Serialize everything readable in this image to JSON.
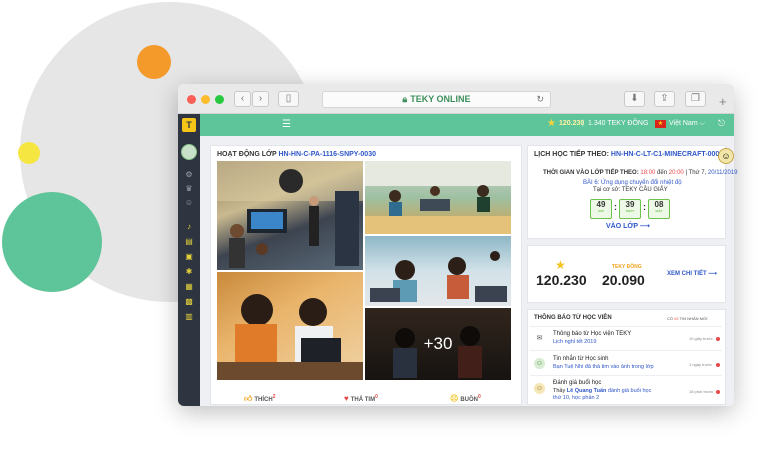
{
  "browser": {
    "url": "TEKY ONLINE"
  },
  "topbar": {
    "points": "120.230",
    "separator": "|",
    "coins_label": "1.340 TEKY ĐỒNG",
    "flag_star": "★",
    "language": "Việt Nam ⌵"
  },
  "activity": {
    "title": "HOẠT ĐỘNG LỚP",
    "class_code": "HN-HN-C-PA-1116-SNPY-0030",
    "more_photos": "+30",
    "likes_label": "THÍCH",
    "likes_count": "2",
    "loves_label": "THẢ TIM",
    "loves_count": "0",
    "sad_label": "BUỒN",
    "sad_count": "0"
  },
  "schedule": {
    "title": "LỊCH HỌC TIẾP THEO:",
    "class_code": "HN-HN-C-LT-C1-MINECRAFT-0001",
    "time_label": "THỜI GIAN VÀO LỚP TIẾP THEO:",
    "time_start": "18:00",
    "time_sep": " đến ",
    "time_end": "20:00",
    "day": "| Thứ 7,",
    "date": "20/11/2019",
    "lesson": "BÀI 6: Ứng dụng chuyển đổi nhiệt độ",
    "location": "Tại cơ sở: TEKY CẦU GIẤY",
    "hours": "49",
    "hours_label": "GIỜ",
    "minutes": "39",
    "minutes_label": "PHÚT",
    "seconds": "08",
    "seconds_label": "GIÂY",
    "join_label": "VÀO LỚP ⟶"
  },
  "stats": {
    "points": "120.230",
    "coins_label": "TEKY ĐỒNG",
    "coins": "20.090",
    "detail_label": "XEM CHI TIẾT ⟶"
  },
  "notifications": {
    "title": "THÔNG BÁO TỪ HỌC VIÊN",
    "count_prefix": "CÓ",
    "count": "02",
    "count_suffix": "TIN NHẮN MỚI",
    "items": [
      {
        "title": "Thông báo từ Học viện TEKY",
        "sub": "Lịch nghỉ tết 2019",
        "time": "10 giây trước"
      },
      {
        "title": "Tin nhắn từ Học sinh",
        "sub": "Bạn Tuệ Nhi đã thả tim vào ảnh trong lớp",
        "time": "1 ngày trước"
      },
      {
        "title": "Đánh giá buổi học",
        "sub_prefix": "Thầy",
        "teacher": "Lê Quang Tuấn",
        "sub": "đánh giá buổi học",
        "sub2": "thứ 10, học phần 2",
        "time": "18 phút trước"
      }
    ]
  },
  "colors": {
    "accent": "#5ec49a",
    "sidebar": "#2f3540",
    "link": "#2f57c8",
    "gold": "#f3a21b"
  }
}
